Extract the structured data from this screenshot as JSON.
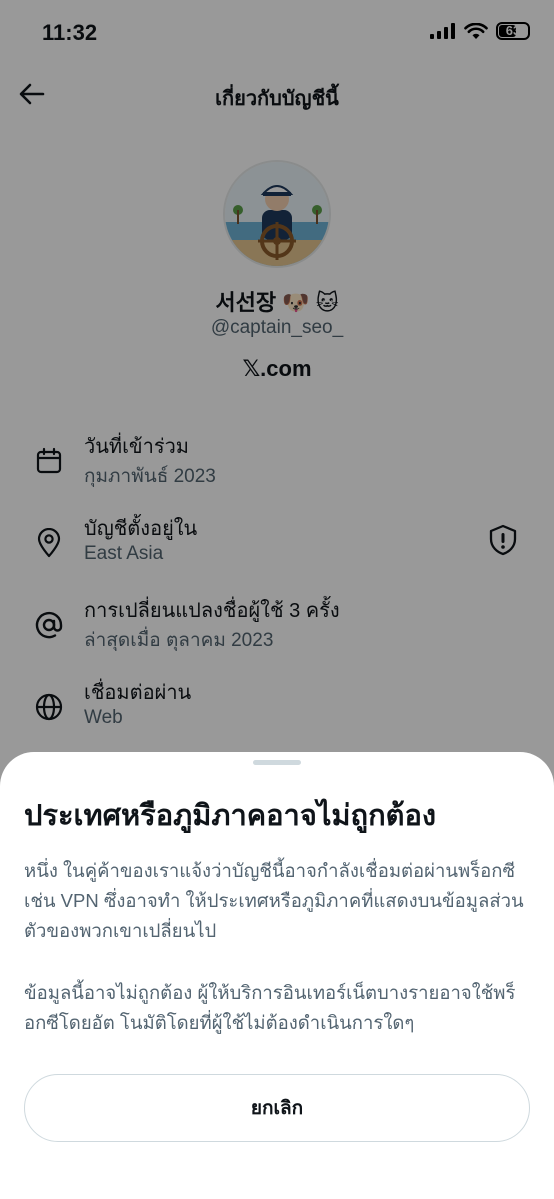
{
  "status_bar": {
    "time": "11:32",
    "battery": "63",
    "battery_level": 0.63
  },
  "nav": {
    "title": "เกี่ยวกับบัญชีนี้"
  },
  "profile": {
    "display_name": "서선장 🐶 🐱",
    "handle": "@captain_seo_",
    "site": "𝕏.com"
  },
  "info": [
    {
      "icon": "calendar-icon",
      "title": "วันที่เข้าร่วม",
      "sub": "กุมภาพันธ์ 2023"
    },
    {
      "icon": "location-pin-icon",
      "title": "บัญชีตั้งอยู่ใน",
      "sub": "East Asia"
    },
    {
      "icon": "at-sign-icon",
      "title": "การเปลี่ยนแปลงชื่อผู้ใช้ 3 ครั้ง",
      "sub": "ล่าสุดเมื่อ ตุลาคม 2023"
    },
    {
      "icon": "globe-icon",
      "title": "เชื่อมต่อผ่าน",
      "sub": "Web"
    }
  ],
  "sheet": {
    "title": "ประเทศหรือภูมิภาคอาจไม่ถูกต้อง",
    "para1": "หนึ่ง ในคู่ค้าของเราแจ้งว่าบัญชีนี้อาจกำลังเชื่อมต่อผ่านพร็อกซี เช่น VPN ซึ่งอาจทำ ให้ประเทศหรือภูมิภาคที่แสดงบนข้อมูลส่วนตัวของพวกเขาเปลี่ยนไป",
    "para2": "ข้อมูลนี้อาจไม่ถูกต้อง ผู้ให้บริการอินเทอร์เน็ตบางรายอาจใช้พร็อกซีโดยอัต โนมัติโดยที่ผู้ใช้ไม่ต้องดำเนินการใดๆ",
    "cancel_label": "ยกเลิก"
  }
}
